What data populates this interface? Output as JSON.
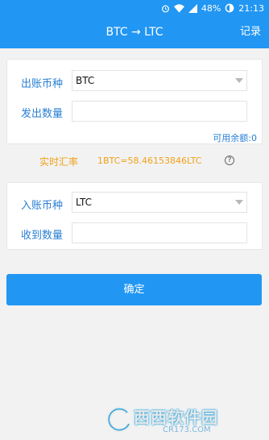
{
  "status_bar": {
    "battery": "48%",
    "time": "21:13",
    "icons": [
      "alarm-icon",
      "wifi-icon",
      "signal-icon",
      "battery-icon"
    ]
  },
  "app_bar": {
    "title": "BTC → LTC",
    "records_label": "记录"
  },
  "send": {
    "currency_label": "出账币种",
    "currency_value": "BTC",
    "amount_label": "发出数量",
    "amount_value": "",
    "available_label": "可用余额:0"
  },
  "rate": {
    "label": "实时汇率",
    "value": "1BTC=58.46153846LTC",
    "help_icon": "?"
  },
  "receive": {
    "currency_label": "入账币种",
    "currency_value": "LTC",
    "amount_label": "收到数量",
    "amount_value": ""
  },
  "confirm_label": "确定",
  "watermark": {
    "brand": "西西软件园",
    "url": "CR173.COM"
  },
  "colors": {
    "primary": "#2196f3",
    "label_blue": "#2a7fd4",
    "rate_orange": "#f0a21a"
  }
}
